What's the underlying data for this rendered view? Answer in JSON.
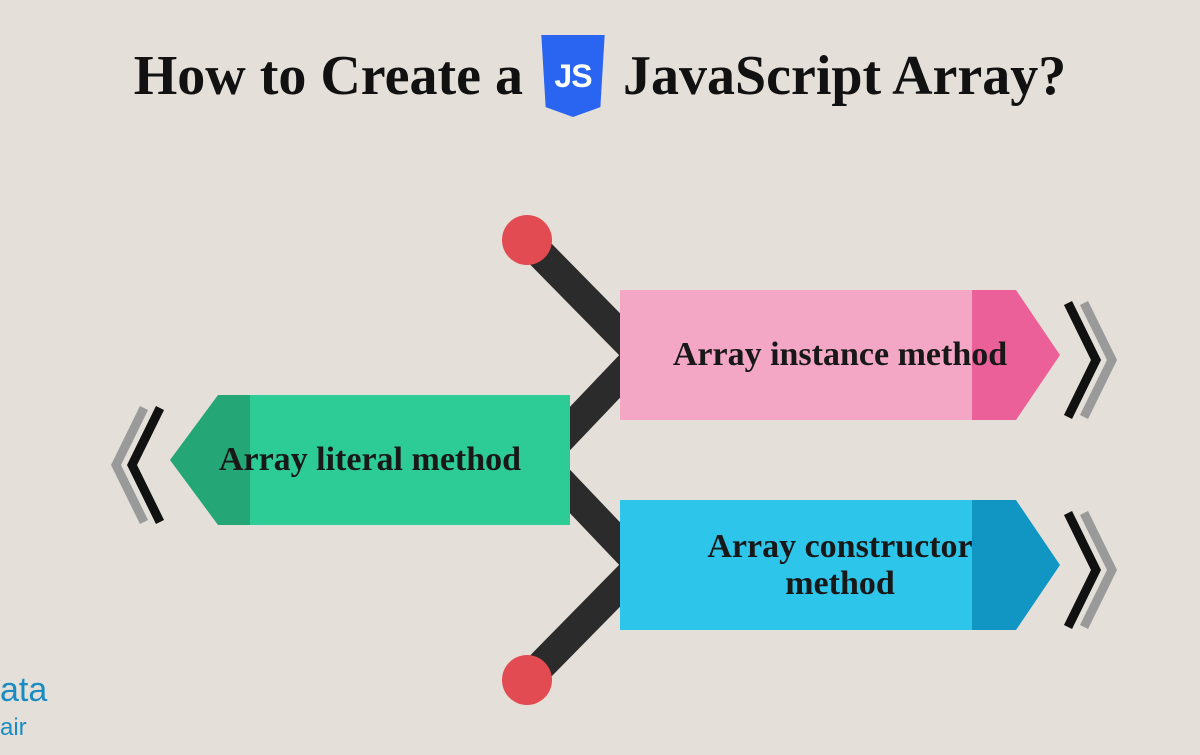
{
  "title": {
    "pre": "How to Create a",
    "post": "JavaScript Array?",
    "badge": "JS"
  },
  "arrows": {
    "left": "Array literal method",
    "up": "Array instance method",
    "down": "Array constructor method"
  },
  "brand": {
    "line1": "ata",
    "line2": "air"
  },
  "colors": {
    "bg": "#e4e0d9",
    "js": "#2965f1",
    "green_light": "#2dcc97",
    "green_dark": "#24a676",
    "pink_light": "#f3a7c4",
    "pink_dark": "#eb6098",
    "blue_light": "#2ec5ea",
    "blue_dark": "#1196c4",
    "connector": "#2b2b2b",
    "dot": "#e24b52"
  }
}
